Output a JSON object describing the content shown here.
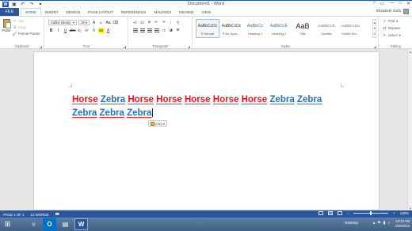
{
  "title_bar": {
    "app_logo": "W",
    "document_title": "Document1 - Word",
    "window_controls": [
      "?",
      "▭",
      "—",
      "□",
      "✕"
    ]
  },
  "tabs": {
    "file": "FILE",
    "items": [
      "HOME",
      "INSERT",
      "DESIGN",
      "PAGE LAYOUT",
      "REFERENCES",
      "MAILINGS",
      "REVIEW",
      "VIEW"
    ],
    "active": "HOME",
    "user_name": "Elizabeth Nofs"
  },
  "ribbon": {
    "clipboard": {
      "paste": "Paste",
      "cut": "Cut",
      "copy": "Copy",
      "format_painter": "Format Painter",
      "label": "Clipboard"
    },
    "font": {
      "font_name": "Calibri (Body)",
      "font_size": "18",
      "label": "Font"
    },
    "paragraph": {
      "pilcrow": "¶",
      "label": "Paragraph"
    },
    "styles": {
      "items": [
        {
          "preview": "AaBbCcDc",
          "name": "¶ Normal"
        },
        {
          "preview": "AaBbCcDc",
          "name": "¶ No Spac..."
        },
        {
          "preview": "AaBbCc",
          "name": "Heading 1"
        },
        {
          "preview": "AaBbCcE",
          "name": "Heading 2"
        },
        {
          "preview": "AaB",
          "name": "Title"
        },
        {
          "preview": "AaBbCcE",
          "name": "Subtitle"
        },
        {
          "preview": "AaBbCcDa",
          "name": "Subtle Em..."
        },
        {
          "preview": "AaBbCcDa",
          "name": "Emphasis"
        }
      ],
      "selected": 0,
      "label": "Styles"
    },
    "editing": {
      "find": "Find",
      "replace": "Replace",
      "select": "Select",
      "label": "Editing"
    }
  },
  "document": {
    "words": [
      "Horse",
      "Zebra",
      "Horse",
      "Horse",
      "Horse",
      "Horse",
      "Horse",
      "Zebra",
      "Zebra",
      "Zebra",
      "Zebra",
      "Zebra"
    ],
    "colors": {
      "Horse": "#e8141e",
      "Zebra": "#1e73be",
      "spell_underline": "#e04040"
    },
    "paste_options_label": "(Ctrl)"
  },
  "status_bar": {
    "page": "PAGE 1 OF 1",
    "words": "12 WORDS",
    "zoom_percent": 100,
    "zoom_label": "140%"
  },
  "taskbar": {
    "desktop": "Desktop",
    "time": "10:23 AM",
    "date": "2/20/2013"
  }
}
